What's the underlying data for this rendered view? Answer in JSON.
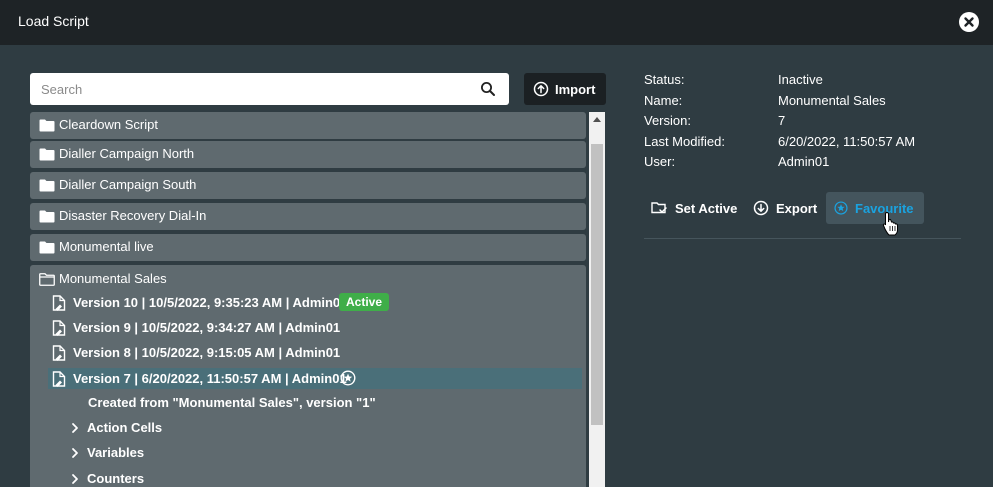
{
  "window": {
    "title": "Load Script"
  },
  "search": {
    "placeholder": "Search"
  },
  "toolbar": {
    "import_label": "Import"
  },
  "tree": {
    "folders": [
      {
        "label": "Cleardown Script"
      },
      {
        "label": "Dialler Campaign North"
      },
      {
        "label": "Dialler Campaign South"
      },
      {
        "label": "Disaster Recovery Dial-In"
      },
      {
        "label": "Monumental live"
      }
    ],
    "open_folder": {
      "label": "Monumental Sales",
      "versions": [
        {
          "label": "Version 10 | 10/5/2022, 9:35:23 AM | Admin01",
          "badge": "Active"
        },
        {
          "label": "Version 9 | 10/5/2022, 9:34:27 AM | Admin01"
        },
        {
          "label": "Version 8 | 10/5/2022, 9:15:05 AM | Admin01"
        },
        {
          "label": "Version 7 | 6/20/2022, 11:50:57 AM | Admin01",
          "selected": true,
          "icon": "favourite-star-icon"
        }
      ],
      "created_note": "Created from \"Monumental Sales\", version \"1\"",
      "children": [
        {
          "label": "Action Cells"
        },
        {
          "label": "Variables"
        },
        {
          "label": "Counters"
        }
      ]
    }
  },
  "details": {
    "status_key": "Status:",
    "status_val": "Inactive",
    "name_key": "Name:",
    "name_val": "Monumental Sales",
    "version_key": "Version:",
    "version_val": "7",
    "modified_key": "Last Modified:",
    "modified_val": "6/20/2022, 11:50:57 AM",
    "user_key": "User:",
    "user_val": "Admin01"
  },
  "actions": {
    "set_active_label": "Set Active",
    "export_label": "Export",
    "favourite_label": "Favourite"
  },
  "colors": {
    "titlebar": "#1e2326",
    "background": "#2f3c42",
    "row": "#5f6a6f",
    "selected_row": "#4a6f79",
    "active_badge": "#3fae49",
    "favourite_accent": "#1aa3e0"
  }
}
